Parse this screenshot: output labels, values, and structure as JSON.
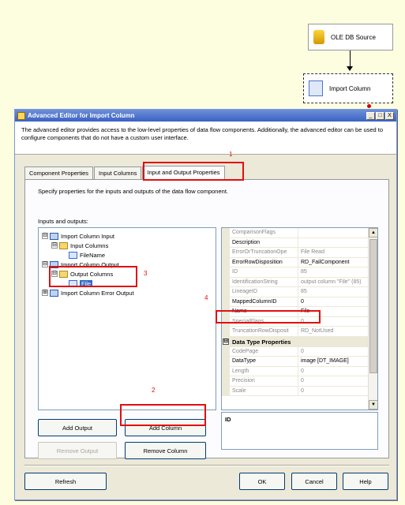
{
  "canvas": {
    "ole_db_source_label": "OLE DB Source",
    "import_column_label": "Import Column"
  },
  "dialog": {
    "title": "Advanced Editor for Import Column",
    "title_buttons": [
      "_",
      "□",
      "X"
    ],
    "header_text": "The advanced editor provides access to the low-level properties of data flow components. Additionally, the advanced editor can be used to configure components that do not have a custom user interface.",
    "tabs": [
      "Component Properties",
      "Input Columns",
      "Input and Output Properties"
    ],
    "panel_description": "Specify properties for the inputs and outputs of the data flow component.",
    "inputs_outputs_label": "Inputs and outputs:",
    "tree": [
      {
        "expander": "⊟",
        "label": "Import Column Input"
      },
      {
        "expander": "⊟",
        "label": "Input Columns"
      },
      {
        "expander": "",
        "label": "FileName"
      },
      {
        "expander": "⊟",
        "label": "Import Column Output"
      },
      {
        "expander": "⊟",
        "label": "Output Columns"
      },
      {
        "expander": "",
        "label": "File"
      },
      {
        "expander": "⊞",
        "label": "Import Column Error Output"
      }
    ],
    "properties": [
      {
        "name": "ComparisonFlags",
        "value": ""
      },
      {
        "name": "Description",
        "value": ""
      },
      {
        "name": "ErrorOrTruncationOpe",
        "value": "File Read"
      },
      {
        "name": "ErrorRowDisposition",
        "value": "RD_FailComponent"
      },
      {
        "name": "ID",
        "value": "85"
      },
      {
        "name": "IdentificationString",
        "value": "output column \"File\" (85)"
      },
      {
        "name": "LineageID",
        "value": "85"
      },
      {
        "name": "MappedColumnID",
        "value": "0"
      },
      {
        "name": "Name",
        "value": "File"
      },
      {
        "name": "SpecialFlags",
        "value": "0"
      },
      {
        "name": "TruncationRowDisposit",
        "value": "RD_NotUsed"
      }
    ],
    "category_label": "Data Type Properties",
    "category_expander": "⊟",
    "data_type_properties": [
      {
        "name": "CodePage",
        "value": "0"
      },
      {
        "name": "DataType",
        "value": "image [DT_IMAGE]"
      },
      {
        "name": "Length",
        "value": "0"
      },
      {
        "name": "Precision",
        "value": "0"
      },
      {
        "name": "Scale",
        "value": "0"
      }
    ],
    "description_box_text": "ID",
    "buttons": {
      "add_output": "Add Output",
      "add_column": "Add Column",
      "remove_output": "Remove Output",
      "remove_column": "Remove Column",
      "refresh": "Refresh",
      "ok": "OK",
      "cancel": "Cancel",
      "help": "Help"
    }
  },
  "annotations": [
    "1",
    "2",
    "3",
    "4"
  ],
  "colors": {
    "highlight": "#e01010",
    "titlebar": "#3a62c4",
    "background": "#fdfde0"
  }
}
